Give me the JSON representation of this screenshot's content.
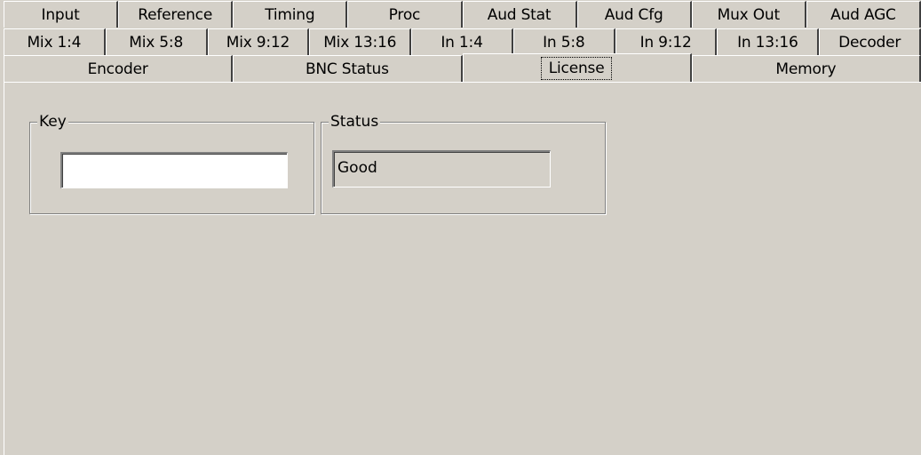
{
  "tabs": {
    "row1": [
      "Input",
      "Reference",
      "Timing",
      "Proc",
      "Aud Stat",
      "Aud Cfg",
      "Mux Out",
      "Aud AGC"
    ],
    "row2": [
      "Mix 1:4",
      "Mix 5:8",
      "Mix 9:12",
      "Mix 13:16",
      "In 1:4",
      "In 5:8",
      "In 9:12",
      "In 13:16",
      "Decoder"
    ],
    "row3": [
      "Encoder",
      "BNC Status",
      "License",
      "Memory"
    ],
    "selected": "License"
  },
  "license_panel": {
    "key_group_label": "Key",
    "key_value": "",
    "status_group_label": "Status",
    "status_value": "Good"
  },
  "colors": {
    "face": "#d4d0c8",
    "highlight": "#ffffff",
    "shadow": "#808080",
    "dark_shadow": "#404040"
  }
}
